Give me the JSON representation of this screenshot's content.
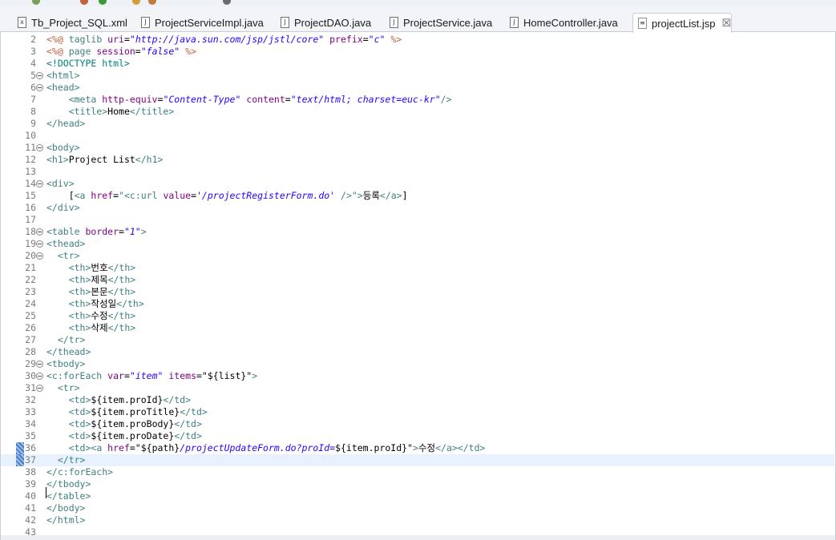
{
  "tabs": [
    {
      "label": "Tb_Project_SQL.xml",
      "icon": "xml-file-icon",
      "glyph": "x",
      "active": false
    },
    {
      "label": "ProjectServiceImpl.java",
      "icon": "java-file-icon",
      "glyph": "J",
      "active": false
    },
    {
      "label": "ProjectDAO.java",
      "icon": "java-file-icon",
      "glyph": "J",
      "active": false
    },
    {
      "label": "ProjectService.java",
      "icon": "java-file-icon",
      "glyph": "J",
      "active": false
    },
    {
      "label": "HomeController.java",
      "icon": "java-file-icon",
      "glyph": "J",
      "active": false
    },
    {
      "label": "projectList.jsp",
      "icon": "jsp-file-icon",
      "glyph": "≡",
      "active": true,
      "close": "☒"
    }
  ],
  "editor": {
    "current_line": 37,
    "lines": [
      {
        "n": "2",
        "fold": false,
        "tokens": [
          [
            "t-dir",
            "<%@ "
          ],
          [
            "t-tag",
            "taglib "
          ],
          [
            "t-attr",
            "uri"
          ],
          [
            "t-text",
            "="
          ],
          [
            "t-val",
            "\"http://java.sun.com/jsp/jstl/core\""
          ],
          [
            "t-text",
            " "
          ],
          [
            "t-attr",
            "prefix"
          ],
          [
            "t-text",
            "="
          ],
          [
            "t-val",
            "\"c\""
          ],
          [
            "t-text",
            " "
          ],
          [
            "t-dir",
            "%>"
          ]
        ]
      },
      {
        "n": "3",
        "fold": false,
        "tokens": [
          [
            "t-dir",
            "<%@ "
          ],
          [
            "t-tag",
            "page "
          ],
          [
            "t-attr",
            "session"
          ],
          [
            "t-text",
            "="
          ],
          [
            "t-val",
            "\"false\""
          ],
          [
            "t-text",
            " "
          ],
          [
            "t-dir",
            "%>"
          ]
        ]
      },
      {
        "n": "4",
        "fold": false,
        "tokens": [
          [
            "t-doc",
            "<!DOCTYPE html>"
          ]
        ]
      },
      {
        "n": "5",
        "fold": true,
        "tokens": [
          [
            "t-tag",
            "<html>"
          ]
        ]
      },
      {
        "n": "6",
        "fold": true,
        "tokens": [
          [
            "t-tag",
            "<head>"
          ]
        ]
      },
      {
        "n": "7",
        "fold": false,
        "tokens": [
          [
            "t-text",
            "    "
          ],
          [
            "t-tag",
            "<meta "
          ],
          [
            "t-attr",
            "http-equiv"
          ],
          [
            "t-text",
            "="
          ],
          [
            "t-val",
            "\"Content-Type\""
          ],
          [
            "t-text",
            " "
          ],
          [
            "t-attr",
            "content"
          ],
          [
            "t-text",
            "="
          ],
          [
            "t-val",
            "\"text/html; charset=euc-kr\""
          ],
          [
            "t-tag",
            "/>"
          ]
        ]
      },
      {
        "n": "8",
        "fold": false,
        "tokens": [
          [
            "t-text",
            "    "
          ],
          [
            "t-tag",
            "<title>"
          ],
          [
            "t-text",
            "Home"
          ],
          [
            "t-tag",
            "</title>"
          ]
        ]
      },
      {
        "n": "9",
        "fold": false,
        "tokens": [
          [
            "t-tag",
            "</head>"
          ]
        ]
      },
      {
        "n": "10",
        "fold": false,
        "tokens": []
      },
      {
        "n": "11",
        "fold": true,
        "tokens": [
          [
            "t-tag",
            "<body>"
          ]
        ]
      },
      {
        "n": "12",
        "fold": false,
        "tokens": [
          [
            "t-tag",
            "<h1>"
          ],
          [
            "t-text",
            "Project List"
          ],
          [
            "t-tag",
            "</h1>"
          ]
        ]
      },
      {
        "n": "13",
        "fold": false,
        "tokens": []
      },
      {
        "n": "14",
        "fold": true,
        "tokens": [
          [
            "t-tag",
            "<div>"
          ]
        ]
      },
      {
        "n": "15",
        "fold": false,
        "tokens": [
          [
            "t-text",
            "    ["
          ],
          [
            "t-tag",
            "<a "
          ],
          [
            "t-attr",
            "href"
          ],
          [
            "t-text",
            "="
          ],
          [
            "t-tag",
            "\"<c:url "
          ],
          [
            "t-attr",
            "value"
          ],
          [
            "t-text",
            "="
          ],
          [
            "t-val",
            "'/projectRegisterForm.do'"
          ],
          [
            "t-text",
            " "
          ],
          [
            "t-tag",
            "/>\">"
          ],
          [
            "t-text",
            "등록"
          ],
          [
            "t-tag",
            "</a>"
          ],
          [
            "t-text",
            "]"
          ]
        ]
      },
      {
        "n": "16",
        "fold": false,
        "tokens": [
          [
            "t-tag",
            "</div>"
          ]
        ]
      },
      {
        "n": "17",
        "fold": false,
        "tokens": []
      },
      {
        "n": "18",
        "fold": true,
        "tokens": [
          [
            "t-tag",
            "<table "
          ],
          [
            "t-attr",
            "border"
          ],
          [
            "t-text",
            "="
          ],
          [
            "t-val",
            "\"1\""
          ],
          [
            "t-tag",
            ">"
          ]
        ]
      },
      {
        "n": "19",
        "fold": true,
        "tokens": [
          [
            "t-tag",
            "<thead>"
          ]
        ]
      },
      {
        "n": "20",
        "fold": true,
        "tokens": [
          [
            "t-text",
            "  "
          ],
          [
            "t-tag",
            "<tr>"
          ]
        ]
      },
      {
        "n": "21",
        "fold": false,
        "tokens": [
          [
            "t-text",
            "    "
          ],
          [
            "t-tag",
            "<th>"
          ],
          [
            "t-text",
            "번호"
          ],
          [
            "t-tag",
            "</th>"
          ]
        ]
      },
      {
        "n": "22",
        "fold": false,
        "tokens": [
          [
            "t-text",
            "    "
          ],
          [
            "t-tag",
            "<th>"
          ],
          [
            "t-text",
            "제목"
          ],
          [
            "t-tag",
            "</th>"
          ]
        ]
      },
      {
        "n": "23",
        "fold": false,
        "tokens": [
          [
            "t-text",
            "    "
          ],
          [
            "t-tag",
            "<th>"
          ],
          [
            "t-text",
            "본문"
          ],
          [
            "t-tag",
            "</th>"
          ]
        ]
      },
      {
        "n": "24",
        "fold": false,
        "tokens": [
          [
            "t-text",
            "    "
          ],
          [
            "t-tag",
            "<th>"
          ],
          [
            "t-text",
            "작성일"
          ],
          [
            "t-tag",
            "</th>"
          ]
        ]
      },
      {
        "n": "25",
        "fold": false,
        "tokens": [
          [
            "t-text",
            "    "
          ],
          [
            "t-tag",
            "<th>"
          ],
          [
            "t-text",
            "수정"
          ],
          [
            "t-tag",
            "</th>"
          ]
        ]
      },
      {
        "n": "26",
        "fold": false,
        "tokens": [
          [
            "t-text",
            "    "
          ],
          [
            "t-tag",
            "<th>"
          ],
          [
            "t-text",
            "삭제"
          ],
          [
            "t-tag",
            "</th>"
          ]
        ]
      },
      {
        "n": "27",
        "fold": false,
        "tokens": [
          [
            "t-text",
            "  "
          ],
          [
            "t-tag",
            "</tr>"
          ]
        ]
      },
      {
        "n": "28",
        "fold": false,
        "tokens": [
          [
            "t-tag",
            "</thead>"
          ]
        ]
      },
      {
        "n": "29",
        "fold": true,
        "tokens": [
          [
            "t-tag",
            "<tbody>"
          ]
        ]
      },
      {
        "n": "30",
        "fold": true,
        "tokens": [
          [
            "t-tag",
            "<c:forEach "
          ],
          [
            "t-attr",
            "var"
          ],
          [
            "t-text",
            "="
          ],
          [
            "t-val",
            "\"item\""
          ],
          [
            "t-text",
            " "
          ],
          [
            "t-attr",
            "items"
          ],
          [
            "t-text",
            "=\"${list}\""
          ],
          [
            "t-tag",
            ">"
          ]
        ]
      },
      {
        "n": "31",
        "fold": true,
        "tokens": [
          [
            "t-text",
            "  "
          ],
          [
            "t-tag",
            "<tr>"
          ]
        ]
      },
      {
        "n": "32",
        "fold": false,
        "tokens": [
          [
            "t-text",
            "    "
          ],
          [
            "t-tag",
            "<td>"
          ],
          [
            "t-text",
            "${item.proId}"
          ],
          [
            "t-tag",
            "</td>"
          ]
        ]
      },
      {
        "n": "33",
        "fold": false,
        "tokens": [
          [
            "t-text",
            "    "
          ],
          [
            "t-tag",
            "<td>"
          ],
          [
            "t-text",
            "${item.proTitle}"
          ],
          [
            "t-tag",
            "</td>"
          ]
        ]
      },
      {
        "n": "34",
        "fold": false,
        "tokens": [
          [
            "t-text",
            "    "
          ],
          [
            "t-tag",
            "<td>"
          ],
          [
            "t-text",
            "${item.proBody}"
          ],
          [
            "t-tag",
            "</td>"
          ]
        ]
      },
      {
        "n": "35",
        "fold": false,
        "tokens": [
          [
            "t-text",
            "    "
          ],
          [
            "t-tag",
            "<td>"
          ],
          [
            "t-text",
            "${item.proDate}"
          ],
          [
            "t-tag",
            "</td>"
          ]
        ]
      },
      {
        "n": "36",
        "fold": false,
        "tokens": [
          [
            "t-text",
            "    "
          ],
          [
            "t-tag",
            "<td><a "
          ],
          [
            "t-attr",
            "href"
          ],
          [
            "t-text",
            "=\"${path}"
          ],
          [
            "t-val",
            "/projectUpdateForm.do?proId="
          ],
          [
            "t-text",
            "${item.proId}\""
          ],
          [
            "t-tag",
            ">"
          ],
          [
            "t-text",
            "수정"
          ],
          [
            "t-tag",
            "</a></td>"
          ]
        ]
      },
      {
        "n": "37",
        "fold": false,
        "tokens": [
          [
            "t-text",
            "  "
          ],
          [
            "t-tag",
            "</tr>"
          ]
        ]
      },
      {
        "n": "38",
        "fold": false,
        "tokens": [
          [
            "t-tag",
            "</c:forEach>"
          ]
        ]
      },
      {
        "n": "39",
        "fold": false,
        "tokens": [
          [
            "t-tag",
            "</tbody>"
          ]
        ]
      },
      {
        "n": "40",
        "fold": false,
        "tokens": [
          [
            "t-tag",
            "</table>"
          ]
        ]
      },
      {
        "n": "41",
        "fold": false,
        "tokens": [
          [
            "t-tag",
            "</body>"
          ]
        ]
      },
      {
        "n": "42",
        "fold": false,
        "tokens": [
          [
            "t-tag",
            "</html>"
          ]
        ]
      },
      {
        "n": "43",
        "fold": false,
        "tokens": []
      }
    ]
  }
}
